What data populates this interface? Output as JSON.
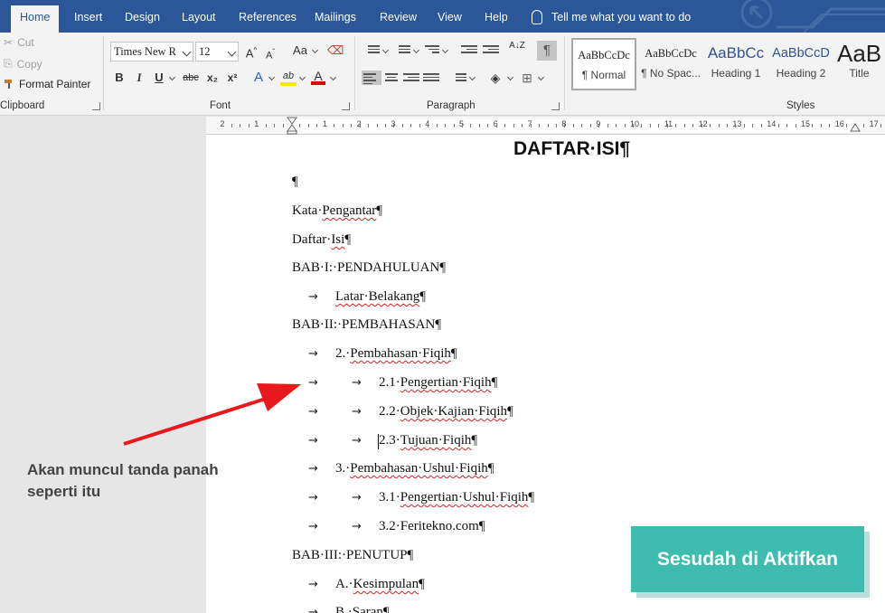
{
  "tabs": [
    "Home",
    "Insert",
    "Design",
    "Layout",
    "References",
    "Mailings",
    "Review",
    "View",
    "Help"
  ],
  "active_tab": "Home",
  "tell_me": "Tell me what you want to do",
  "clipboard": {
    "cut": "Cut",
    "copy": "Copy",
    "format_painter": "Format Painter",
    "label": "Clipboard"
  },
  "font": {
    "name": "Times New R",
    "size": "12",
    "label": "Font",
    "grow": "A",
    "shrink": "A",
    "change_case": "Aa",
    "bold": "B",
    "italic": "I",
    "underline": "U",
    "strike": "abc",
    "subscript": "x₂",
    "superscript": "x²",
    "effects": "A",
    "highlight": "ab",
    "font_color": "A",
    "highlight_color": "#ffe600",
    "font_color_value": "#e00000"
  },
  "paragraph": {
    "label": "Paragraph",
    "show_marks": "¶",
    "sort": "A↓Z"
  },
  "styles": {
    "label": "Styles",
    "items": [
      {
        "sample": "AaBbCcDc",
        "name": "¶ Normal"
      },
      {
        "sample": "AaBbCcDc",
        "name": "¶ No Spac..."
      },
      {
        "sample": "AaBbCc",
        "name": "Heading 1"
      },
      {
        "sample": "AaBbCcD",
        "name": "Heading 2"
      },
      {
        "sample": "AaB",
        "name": "Title"
      }
    ]
  },
  "ruler": {
    "numbers": [
      "2",
      "1",
      "1",
      "2",
      "3",
      "4",
      "5",
      "6",
      "7",
      "8",
      "9",
      "10",
      "11",
      "12",
      "13",
      "14",
      "15",
      "16",
      "17"
    ]
  },
  "document": {
    "title": "DAFTAR·ISI¶",
    "pilcrow": "¶",
    "tab_arrow": "→",
    "lines": {
      "kata_pengantar": {
        "a": "Kata·",
        "b": "Pengantar",
        "c": "¶"
      },
      "daftar_isi": {
        "a": "Daftar·",
        "b": "Isi",
        "c": "¶"
      },
      "bab1": "BAB·I:·PENDAHULUAN¶",
      "latar": {
        "a": "Latar·Belakang",
        "c": "¶"
      },
      "bab2": "BAB·II:·PEMBAHASAN¶",
      "pf": {
        "a": "2.·",
        "b": "Pembahasan·Fiqih",
        "c": "¶"
      },
      "p21": {
        "a": "2.1·",
        "b": "Pengertian·Fiqih",
        "c": "¶"
      },
      "p22": {
        "a": "2.2·",
        "b": "Objek·Kajian·Fiqih",
        "c": "¶"
      },
      "p23": {
        "a": "2.3·",
        "b": "Tujuan·Fiqih",
        "c": "¶"
      },
      "pu": {
        "a": "3.·",
        "b": "Pembahasan·Ushul·Fiqih",
        "c": "¶"
      },
      "p31": {
        "a": "3.1·",
        "b": "Pengertian·Ushul·Fiqih",
        "c": "¶"
      },
      "p32": "3.2·Feritekno.com¶",
      "bab3": "BAB·III:·PENUTUP¶",
      "ka": {
        "a": "A.·",
        "b": "Kesimpulan",
        "c": "¶"
      },
      "kb": "B.·Saran¶"
    }
  },
  "annotation": {
    "note": "Akan muncul tanda panah seperti itu",
    "badge": "Sesudah di Aktifkan",
    "arrow_color": "#e8191c",
    "badge_color": "#3fbcb0"
  }
}
